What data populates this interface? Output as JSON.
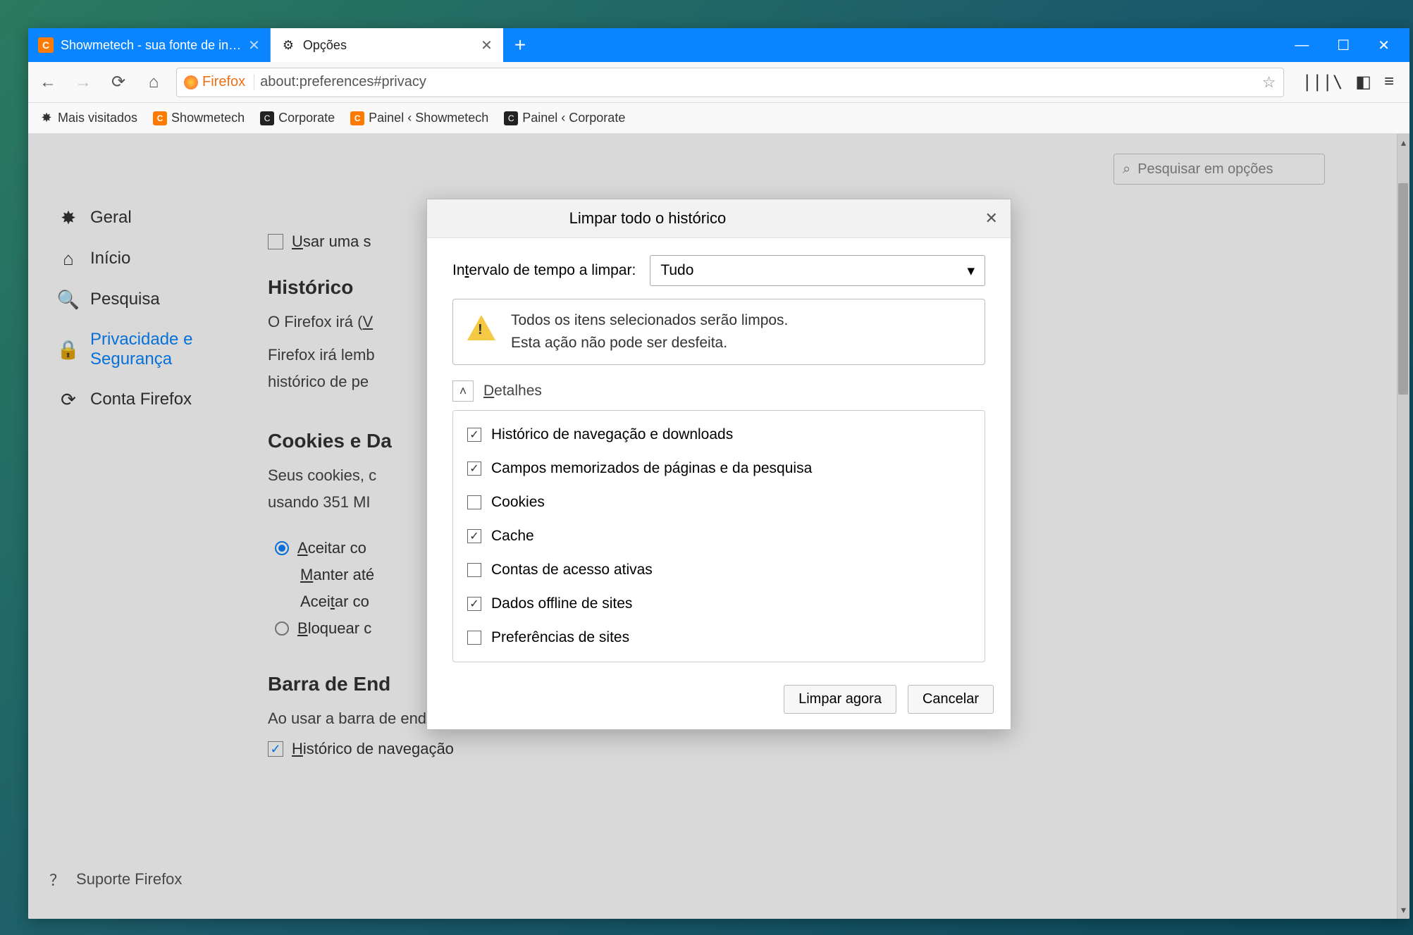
{
  "tabs": [
    {
      "label": "Showmetech - sua fonte de in…",
      "active": false
    },
    {
      "label": "Opções",
      "active": true
    }
  ],
  "url_bar": {
    "brand": "Firefox",
    "url": "about:preferences#privacy"
  },
  "bookmarks": [
    "Mais visitados",
    "Showmetech",
    "Corporate",
    "Painel ‹ Showmetech",
    "Painel ‹ Corporate"
  ],
  "sidebar": {
    "items": [
      {
        "label": "Geral"
      },
      {
        "label": "Início"
      },
      {
        "label": "Pesquisa"
      },
      {
        "label": "Privacidade e Segurança",
        "active": true
      },
      {
        "label": "Conta Firefox"
      }
    ],
    "support": "Suporte Firefox"
  },
  "search_placeholder": "Pesquisar em opções",
  "main": {
    "use_one": "Usar uma s",
    "historico_title": "Histórico",
    "historico_line1": "O Firefox irá (V",
    "historico_line2": "Firefox irá lemb",
    "historico_line3": "histórico de pe",
    "cookies_title": "Cookies e Da",
    "cookies_line1": "Seus cookies, c",
    "cookies_line2": "usando 351 MI",
    "aceitar": "Aceitar co",
    "manter": "Manter até",
    "aceitar2": "Aceitar co",
    "bloquear": "Bloquear c",
    "barra_title": "Barra de End",
    "barra_line": "Ao usar a barra de endereços, sugerir",
    "hist_nav": "Histórico de navegação"
  },
  "dialog": {
    "title": "Limpar todo o histórico",
    "range_label": "Intervalo de tempo a limpar:",
    "range_value": "Tudo",
    "warn1": "Todos os itens selecionados serão limpos.",
    "warn2": "Esta ação não pode ser desfeita.",
    "details": "Detalhes",
    "items": [
      {
        "label": "Histórico de navegação e downloads",
        "checked": true
      },
      {
        "label": "Campos memorizados de páginas e da pesquisa",
        "checked": true
      },
      {
        "label": "Cookies",
        "checked": false
      },
      {
        "label": "Cache",
        "checked": true
      },
      {
        "label": "Contas de acesso ativas",
        "checked": false
      },
      {
        "label": "Dados offline de sites",
        "checked": true
      },
      {
        "label": "Preferências de sites",
        "checked": false
      }
    ],
    "ok": "Limpar agora",
    "cancel": "Cancelar"
  }
}
